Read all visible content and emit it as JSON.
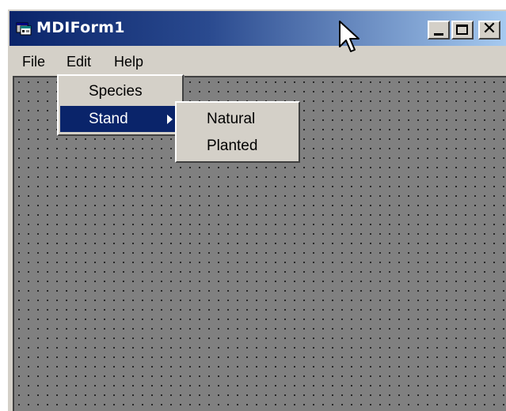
{
  "window": {
    "title": "MDIForm1",
    "minimize_icon": "minimize-icon",
    "maximize_icon": "maximize-icon",
    "close_glyph": "✕",
    "app_icon": "form-app-icon"
  },
  "menubar": {
    "items": [
      {
        "label": "File"
      },
      {
        "label": "Edit"
      },
      {
        "label": "Help"
      }
    ]
  },
  "edit_menu": {
    "items": [
      {
        "label": "Species",
        "selected": false
      },
      {
        "label": "Stand",
        "selected": true,
        "has_submenu": true
      }
    ]
  },
  "stand_submenu": {
    "items": [
      {
        "label": "Natural"
      },
      {
        "label": "Planted"
      }
    ]
  },
  "colors": {
    "title_active_start": "#0a246a",
    "title_active_end": "#a6caf0",
    "selection": "#0a246a",
    "face": "#d4d0c8",
    "mdi_background": "#808080"
  }
}
